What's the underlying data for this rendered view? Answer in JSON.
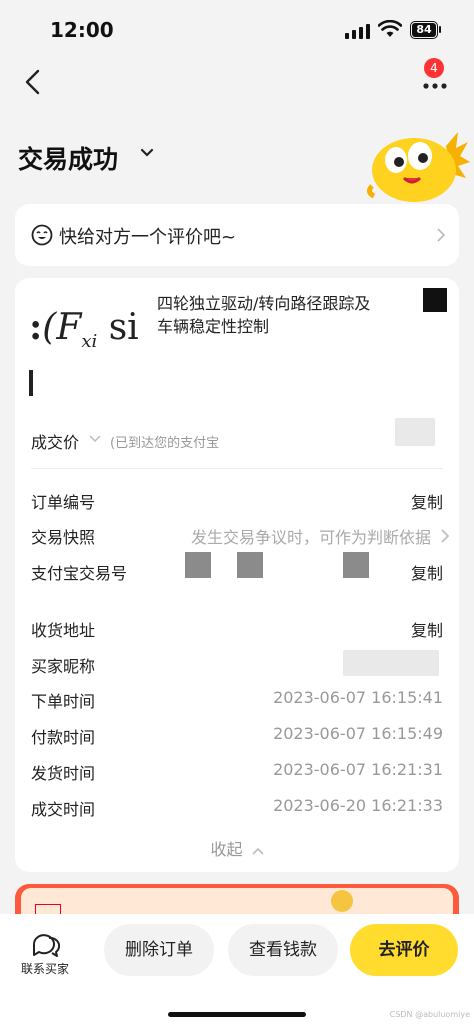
{
  "status_bar": {
    "time": "12:00",
    "battery": "84"
  },
  "nav": {
    "badge_count": "4"
  },
  "page_title": "交易成功",
  "review_prompt": "快给对方一个评价吧~",
  "product": {
    "formula_main": "(F",
    "formula_sub": "xi",
    "formula_tail": " si",
    "title": "四轮独立驱动/转向路径跟踪及车辆稳定性控制"
  },
  "price": {
    "label": "成交价",
    "note": "(已到达您的支付宝"
  },
  "rows": {
    "order_no": {
      "label": "订单编号",
      "action": "复制"
    },
    "snapshot": {
      "label": "交易快照",
      "value": "发生交易争议时，可作为判断依据"
    },
    "alipay_no": {
      "label": "支付宝交易号",
      "action": "复制"
    },
    "address": {
      "label": "收货地址",
      "action": "复制"
    },
    "buyer": {
      "label": "买家昵称"
    },
    "order_time": {
      "label": "下单时间",
      "value": "2023-06-07 16:15:41"
    },
    "pay_time": {
      "label": "付款时间",
      "value": "2023-06-07 16:15:49"
    },
    "ship_time": {
      "label": "发货时间",
      "value": "2023-06-07 16:21:31"
    },
    "deal_time": {
      "label": "成交时间",
      "value": "2023-06-20 16:21:33"
    }
  },
  "collapse_label": "收起",
  "bottom": {
    "contact": "联系买家",
    "delete": "删除订单",
    "wallet": "查看钱款",
    "review": "去评价"
  },
  "watermark": "CSDN @abuluomiye",
  "colors": {
    "accent": "#ffdc2e",
    "badge": "#ff3333",
    "promo": "#ff5a3c"
  }
}
